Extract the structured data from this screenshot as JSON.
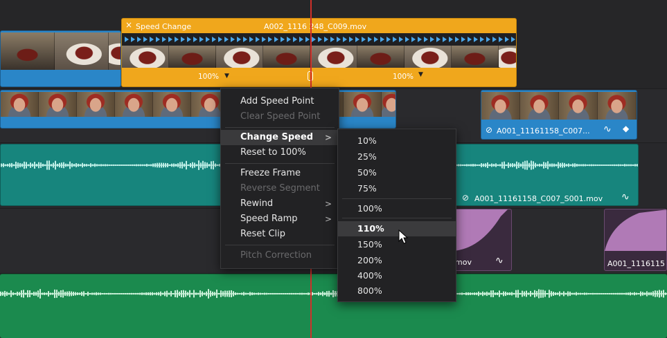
{
  "colors": {
    "video_clip_blue": "#2a86c8",
    "speed_change_orange": "#f0a71c",
    "audio_teal": "#17857d",
    "audio_green": "#1b8a4e",
    "audio_purple": "#b07ab6",
    "playhead_red": "#d0302a",
    "menu_bg": "#222224"
  },
  "speed_clip": {
    "header_label": "Speed Change",
    "close_icon": "×",
    "filename": "A002_1116 248_C009.mov",
    "speed_left": "100%",
    "speed_right": "100%"
  },
  "video_clip_v1_right": {
    "name": "A001_11161158_C007...",
    "link_icon": "link-icon",
    "curve_icon": "curve-icon",
    "keyframe_icon": "keyframe-diamond-icon"
  },
  "audio_clip_teal": {
    "name": "A001_11161158_C007_S001.mov"
  },
  "audio_clip_purple_left": {
    "name": "mov"
  },
  "audio_clip_purple_right": {
    "name": "A001_1116115"
  },
  "context_menu": {
    "items": [
      {
        "label": "Add Speed Point",
        "disabled": false
      },
      {
        "label": "Clear Speed Point",
        "disabled": true
      },
      {
        "label": "Change Speed",
        "disabled": false,
        "submenu": true,
        "active": true
      },
      {
        "label": "Reset to 100%",
        "disabled": false
      },
      {
        "label": "Freeze Frame",
        "disabled": false
      },
      {
        "label": "Reverse Segment",
        "disabled": true
      },
      {
        "label": "Rewind",
        "disabled": false,
        "submenu": true
      },
      {
        "label": "Speed Ramp",
        "disabled": false,
        "submenu": true
      },
      {
        "label": "Reset Clip",
        "disabled": false
      },
      {
        "label": "Pitch Correction",
        "disabled": true
      }
    ],
    "submenu_arrow": ">"
  },
  "speed_submenu": {
    "items": [
      "10%",
      "25%",
      "50%",
      "75%",
      "100%",
      "110%",
      "150%",
      "200%",
      "400%",
      "800%"
    ],
    "highlighted": "110%"
  }
}
